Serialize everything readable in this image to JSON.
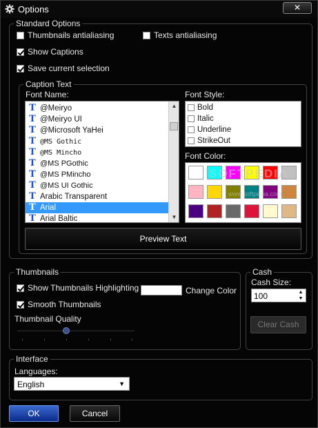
{
  "window": {
    "title": "Options",
    "close_label": "✕"
  },
  "standard": {
    "title": "Standard Options",
    "thumbnails_antialiasing": "Thumbnails antialiasing",
    "texts_antialiasing": "Texts antialiasing",
    "show_captions": "Show Captions",
    "save_selection": "Save current selection"
  },
  "caption": {
    "title": "Caption Text",
    "font_name_label": "Font Name:",
    "fonts": [
      "@Meiryo",
      "@Meiryo UI",
      "@Microsoft YaHei",
      "@MS Gothic",
      "@MS Mincho",
      "@MS PGothic",
      "@MS PMincho",
      "@MS UI Gothic",
      "Arabic Transparent",
      "Arial",
      "Arial Baltic"
    ],
    "font_icon": "T",
    "selected_font": "Arial",
    "font_style_label": "Font Style:",
    "styles": [
      "Bold",
      "Italic",
      "Underline",
      "StrikeOut"
    ],
    "font_color_label": "Font Color:",
    "colors": [
      "#ffffff",
      "#00ffff",
      "#ff00ff",
      "#ffff00",
      "#ff0000",
      "#c0c0c0",
      "#ffb6c1",
      "#ffd700",
      "#808000",
      "#008080",
      "#800080",
      "#cd853f",
      "#4b0082",
      "#b22222",
      "#696969",
      "#dc143c",
      "#fffacd",
      "#deb887"
    ],
    "preview_button": "Preview Text",
    "watermark": "SOFTPEDIA",
    "watermark_url": "www.softpedia.com"
  },
  "thumbs": {
    "title": "Thumbnails",
    "show_highlighting": "Show Thumbnails Highlighting",
    "smooth": "Smooth Thumbnails",
    "change_color": "Change Color",
    "quality_label": "Thumbnail Quality"
  },
  "cash": {
    "title": "Cash",
    "size_label": "Cash Size:",
    "size_value": "100",
    "clear_button": "Clear Cash"
  },
  "interface": {
    "title": "Interface",
    "languages_label": "Languages:",
    "language_value": "English"
  },
  "footer": {
    "ok": "OK",
    "cancel": "Cancel"
  }
}
